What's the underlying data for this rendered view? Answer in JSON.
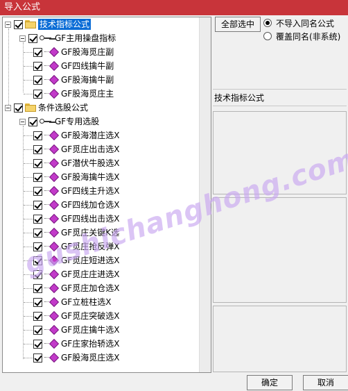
{
  "window": {
    "title": "导入公式"
  },
  "tree": {
    "groups": [
      {
        "label": "技术指标公式",
        "subgroup": "GF主用操盘指标",
        "items": [
          "GF股海觅庄副",
          "GF四线擒牛副",
          "GF股海擒牛副",
          "GF股海觅庄主"
        ]
      },
      {
        "label": "条件选股公式",
        "subgroup": "GF专用选股",
        "items": [
          "GF股海潜庄选X",
          "GF觅庄出击选X",
          "GF潜伏牛股选X",
          "GF股海擒牛选X",
          "GF四线主升选X",
          "GF四线加仓选X",
          "GF四线出击选X",
          "GF觅庄关键K选",
          "GF觅庄抢反弹X",
          "GF觅庄短进选X",
          "GF觅庄庄进选X",
          "GF觅庄加仓选X",
          "GF立桩柱选X",
          "GF觅庄突破选X",
          "GF觅庄擒牛选X",
          "GF庄家抬轿选X",
          "GF股海觅庄选X"
        ]
      }
    ]
  },
  "options": {
    "select_all": "全部选中",
    "radio_skip": "不导入同名公式",
    "radio_overwrite": "覆盖同名(非系统)",
    "selected": "skip"
  },
  "info": {
    "category": "技术指标公式"
  },
  "footer": {
    "ok": "确定",
    "cancel": "取消"
  },
  "watermark": "gushichanghong.com"
}
